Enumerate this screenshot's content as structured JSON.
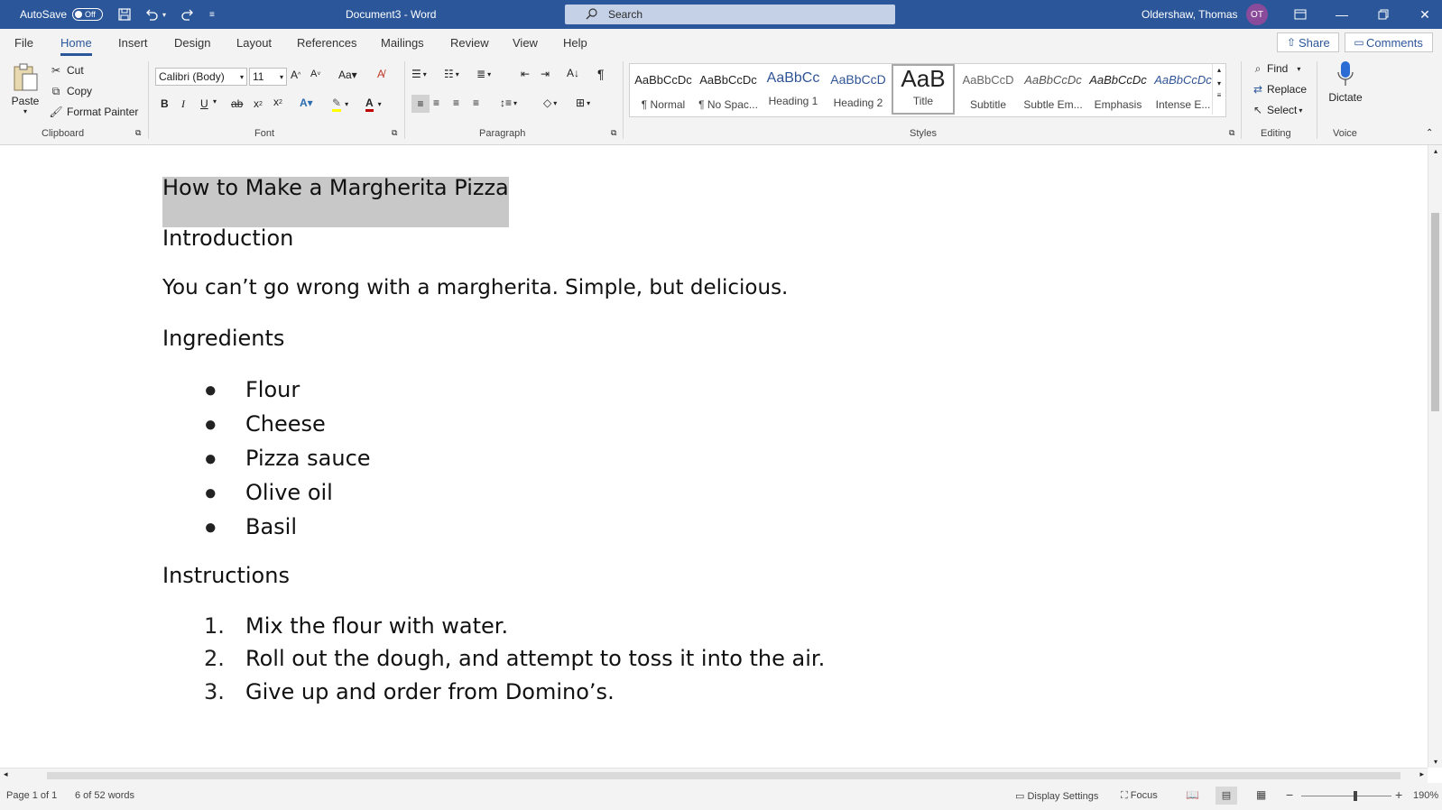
{
  "titlebar": {
    "autosave_label": "AutoSave",
    "autosave_state": "Off",
    "document_title": "Document3  -  Word",
    "search_placeholder": "Search",
    "user_name": "Oldershaw, Thomas",
    "user_initials": "OT"
  },
  "menu": {
    "items": [
      "File",
      "Home",
      "Insert",
      "Design",
      "Layout",
      "References",
      "Mailings",
      "Review",
      "View",
      "Help"
    ],
    "active": "Home",
    "share_label": "Share",
    "comments_label": "Comments"
  },
  "ribbon": {
    "clipboard": {
      "paste_label": "Paste",
      "cut_label": "Cut",
      "copy_label": "Copy",
      "format_painter_label": "Format Painter",
      "group_label": "Clipboard"
    },
    "font": {
      "font_name": "Calibri (Body)",
      "font_size": "11",
      "group_label": "Font"
    },
    "paragraph": {
      "group_label": "Paragraph"
    },
    "styles": {
      "items": [
        {
          "sample": "AaBbCcDc",
          "name": "¶ Normal"
        },
        {
          "sample": "AaBbCcDc",
          "name": "¶ No Spac..."
        },
        {
          "sample": "AaBbCc",
          "name": "Heading 1"
        },
        {
          "sample": "AaBbCcD",
          "name": "Heading 2"
        },
        {
          "sample": "AaB",
          "name": "Title"
        },
        {
          "sample": "AaBbCcD",
          "name": "Subtitle"
        },
        {
          "sample": "AaBbCcDc",
          "name": "Subtle Em..."
        },
        {
          "sample": "AaBbCcDc",
          "name": "Emphasis"
        },
        {
          "sample": "AaBbCcDc",
          "name": "Intense E..."
        }
      ],
      "selected": "Title",
      "group_label": "Styles"
    },
    "editing": {
      "find_label": "Find",
      "replace_label": "Replace",
      "select_label": "Select",
      "group_label": "Editing"
    },
    "voice": {
      "dictate_label": "Dictate",
      "group_label": "Voice"
    }
  },
  "document": {
    "title": "How to Make a Margherita Pizza",
    "intro_heading": "Introduction",
    "intro_text": "You can’t go wrong with a margherita. Simple, but delicious.",
    "ingredients_heading": "Ingredients",
    "ingredients": [
      "Flour",
      "Cheese",
      "Pizza sauce",
      "Olive oil",
      "Basil"
    ],
    "instructions_heading": "Instructions",
    "instructions": [
      {
        "num": "1.",
        "text": "Mix the flour with water."
      },
      {
        "num": "2.",
        "text": "Roll out the dough, and attempt to toss it into the air."
      },
      {
        "num": "3.",
        "text": "Give up and order from Domino’s."
      }
    ]
  },
  "status": {
    "page": "Page 1 of 1",
    "words": "6 of 52 words",
    "display_settings": "Display Settings",
    "focus": "Focus",
    "zoom": "190%"
  },
  "colors": {
    "accent": "#2b579a",
    "ribbon_bg": "#f3f3f3",
    "selection": "#c8c8c8"
  }
}
